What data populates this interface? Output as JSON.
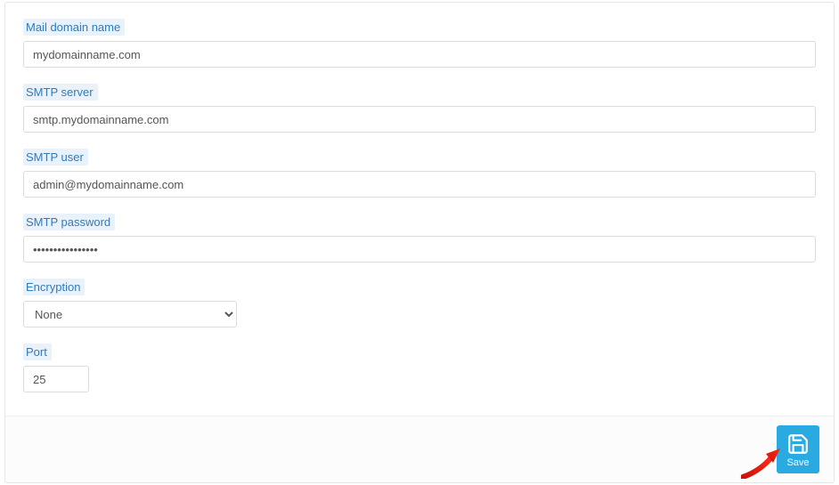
{
  "fields": {
    "mail_domain": {
      "label": "Mail domain name",
      "value": "mydomainname.com"
    },
    "smtp_server": {
      "label": "SMTP server",
      "value": "smtp.mydomainname.com"
    },
    "smtp_user": {
      "label": "SMTP user",
      "value": "admin@mydomainname.com"
    },
    "smtp_pass": {
      "label": "SMTP password",
      "value": "••••••••••••••••"
    },
    "encryption": {
      "label": "Encryption",
      "value": "None"
    },
    "port": {
      "label": "Port",
      "value": "25"
    }
  },
  "actions": {
    "save_label": "Save"
  },
  "colors": {
    "accent": "#29abe2",
    "label_bg": "#e9f2fb",
    "label_fg": "#337ab7"
  }
}
